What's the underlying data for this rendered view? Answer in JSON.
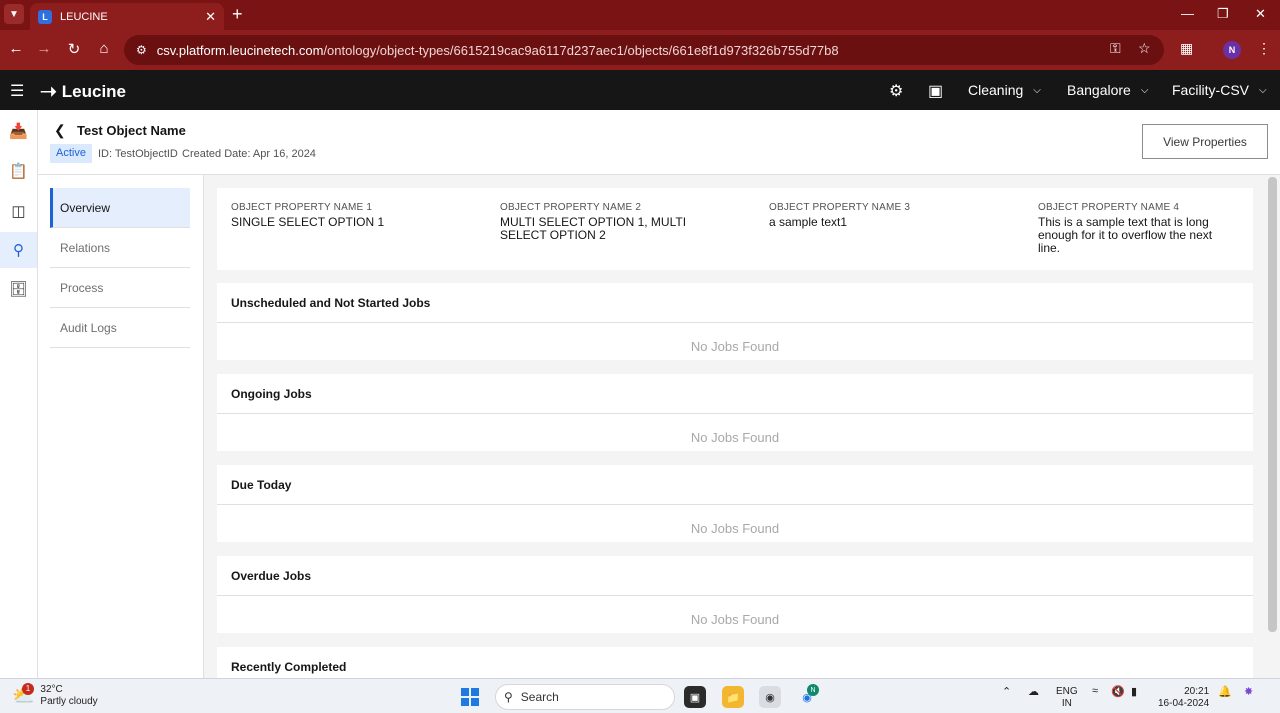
{
  "browser": {
    "tab_title": "LEUCINE",
    "tab_favicon": "L",
    "url_host": "csv.platform.leucinetech.com",
    "url_path": "/ontology/object-types/6615219cac9a6117d237aec1/objects/661e8f1d973f326b755d77b8",
    "profile_initial": "N"
  },
  "app": {
    "brand": "Leucine",
    "selectors": [
      "Cleaning",
      "Bangalore",
      "Facility-CSV"
    ]
  },
  "page": {
    "title": "Test Object Name",
    "status": "Active",
    "id_text": "ID: TestObjectID",
    "created_text": "Created Date: Apr 16, 2024",
    "view_properties_label": "View Properties"
  },
  "nav": {
    "items": [
      "Overview",
      "Relations",
      "Process",
      "Audit Logs"
    ]
  },
  "properties": [
    {
      "label": "OBJECT PROPERTY NAME 1",
      "value": "SINGLE SELECT OPTION 1"
    },
    {
      "label": "OBJECT PROPERTY NAME 2",
      "value": "MULTI SELECT OPTION 1, MULTI SELECT OPTION 2"
    },
    {
      "label": "OBJECT PROPERTY NAME 3",
      "value": "a sample text1"
    },
    {
      "label": "OBJECT PROPERTY NAME 4",
      "value": "This is a sample text that is long enough for it to overflow the next line."
    }
  ],
  "job_sections": [
    {
      "title": "Unscheduled and Not Started Jobs",
      "empty": "No Jobs Found"
    },
    {
      "title": "Ongoing Jobs",
      "empty": "No Jobs Found"
    },
    {
      "title": "Due Today",
      "empty": "No Jobs Found"
    },
    {
      "title": "Overdue Jobs",
      "empty": "No Jobs Found"
    },
    {
      "title": "Recently Completed",
      "empty": ""
    }
  ],
  "taskbar": {
    "weather_badge": "1",
    "temperature": "32°C",
    "condition": "Partly cloudy",
    "search_label": "Search",
    "lang_top": "ENG",
    "lang_bottom": "IN",
    "time": "20:21",
    "date": "16-04-2024",
    "app_badge": "N"
  }
}
